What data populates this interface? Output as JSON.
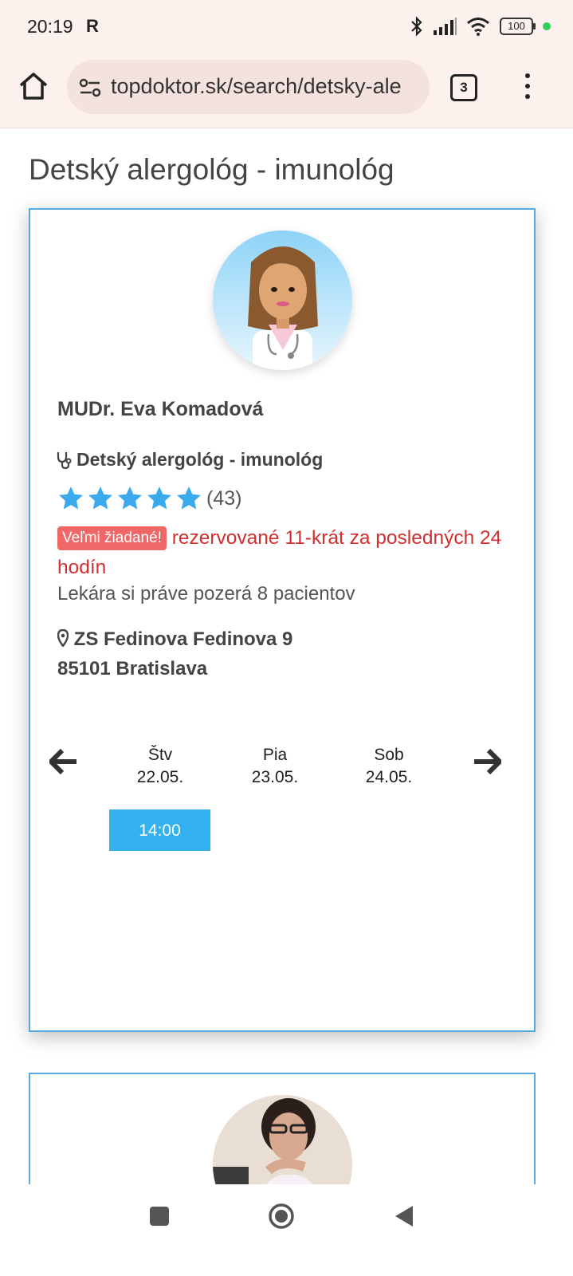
{
  "status_bar": {
    "time": "20:19",
    "indicator": "R",
    "battery": "100",
    "icons": [
      "bluetooth-icon",
      "signal-icon",
      "wifi-icon",
      "battery-icon"
    ]
  },
  "browser": {
    "url": "topdoktor.sk/search/detsky-ale",
    "tab_count": "3"
  },
  "page": {
    "title": "Detský alergológ - imunológ"
  },
  "doctor": {
    "name": "MUDr. Eva Komadová",
    "specialty": "Detský alergológ - imunológ",
    "rating_stars": 5,
    "rating_count": "(43)",
    "badge": "Veľmi žiadané!",
    "demand_text": "rezervované 11-krát za posledných 24 hodín",
    "watching": "Lekára si práve pozerá 8 pacientov",
    "address_line1": "ZS Fedinova Fedinova 9",
    "address_line2": "85101 Bratislava"
  },
  "schedule": {
    "days": [
      {
        "name": "Štv",
        "date": "22.05."
      },
      {
        "name": "Pia",
        "date": "23.05."
      },
      {
        "name": "Sob",
        "date": "24.05."
      }
    ],
    "slots": [
      "14:00"
    ]
  },
  "colors": {
    "accent": "#33b1f0",
    "card_border": "#56aadf",
    "demand_red": "#d32f2f",
    "badge_bg": "#f06767"
  }
}
